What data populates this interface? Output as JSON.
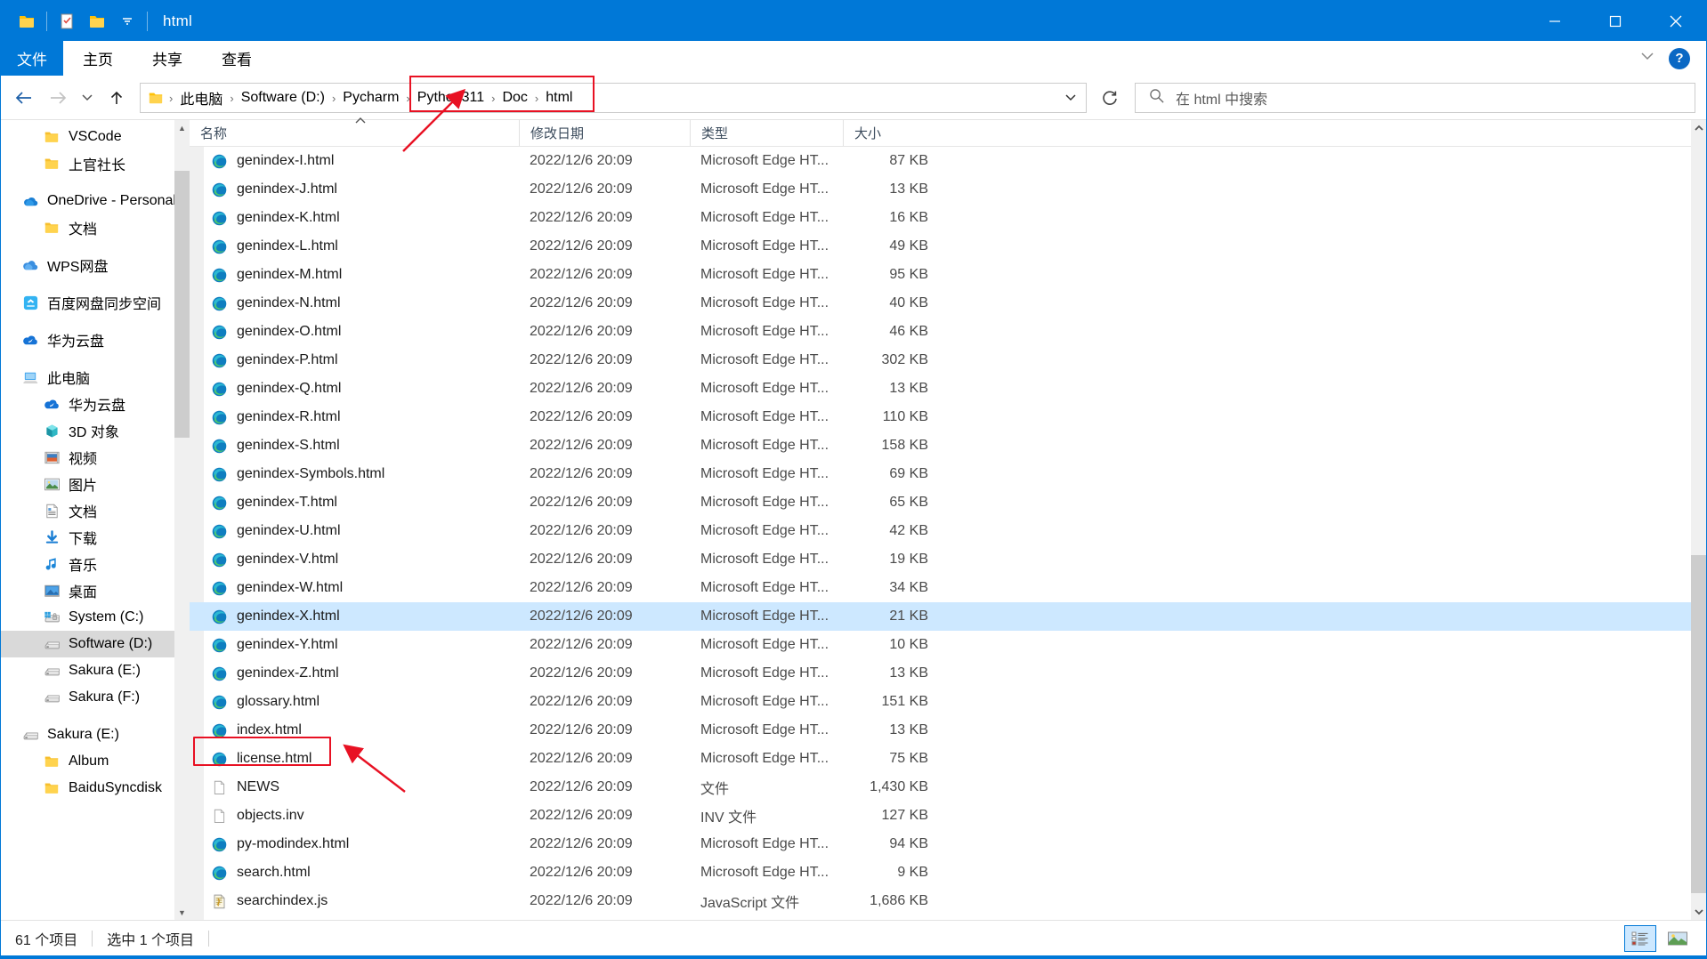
{
  "window": {
    "title": "html",
    "quick_access": [
      "folder-icon",
      "properties-icon",
      "new-folder-icon",
      "chevron-down-icon"
    ],
    "controls": {
      "minimize": "—",
      "maximize": "☐",
      "close": "✕"
    }
  },
  "ribbon": {
    "file_tab": "文件",
    "tabs": [
      "主页",
      "共享",
      "查看"
    ],
    "expand_label": "⌄",
    "help_label": "?"
  },
  "nav": {
    "back": "←",
    "forward": "→",
    "recent": "⌄",
    "up": "↑",
    "refresh": "↻",
    "address_caret": "⌄",
    "breadcrumbs": [
      "此电脑",
      "Software (D:)",
      "Pycharm",
      "Python311",
      "Doc",
      "html"
    ],
    "separator": "›",
    "highlight_from_index": 3
  },
  "search": {
    "placeholder": "在 html 中搜索",
    "icon": "search-icon"
  },
  "sidebar": {
    "items": [
      {
        "label": "VSCode",
        "icon": "folder-icon",
        "indent": 1,
        "selected": false,
        "gap_before": false
      },
      {
        "label": "上官社长",
        "icon": "folder-icon",
        "indent": 1,
        "selected": false,
        "gap_before": false
      },
      {
        "label": "OneDrive - Personal",
        "icon": "onedrive-icon",
        "indent": 0,
        "selected": false,
        "gap_before": true
      },
      {
        "label": "文档",
        "icon": "folder-icon",
        "indent": 1,
        "selected": false,
        "gap_before": false
      },
      {
        "label": "WPS网盘",
        "icon": "wps-cloud-icon",
        "indent": 0,
        "selected": false,
        "gap_before": true
      },
      {
        "label": "百度网盘同步空间",
        "icon": "baidu-cloud-icon",
        "indent": 0,
        "selected": false,
        "gap_before": true
      },
      {
        "label": "华为云盘",
        "icon": "huawei-cloud-icon",
        "indent": 0,
        "selected": false,
        "gap_before": true
      },
      {
        "label": "此电脑",
        "icon": "this-pc-icon",
        "indent": 0,
        "selected": false,
        "gap_before": true
      },
      {
        "label": "华为云盘",
        "icon": "huawei-cloud-icon",
        "indent": 1,
        "selected": false,
        "gap_before": false
      },
      {
        "label": "3D 对象",
        "icon": "3d-objects-icon",
        "indent": 1,
        "selected": false,
        "gap_before": false
      },
      {
        "label": "视频",
        "icon": "videos-icon",
        "indent": 1,
        "selected": false,
        "gap_before": false
      },
      {
        "label": "图片",
        "icon": "pictures-icon",
        "indent": 1,
        "selected": false,
        "gap_before": false
      },
      {
        "label": "文档",
        "icon": "documents-icon",
        "indent": 1,
        "selected": false,
        "gap_before": false
      },
      {
        "label": "下载",
        "icon": "downloads-icon",
        "indent": 1,
        "selected": false,
        "gap_before": false
      },
      {
        "label": "音乐",
        "icon": "music-icon",
        "indent": 1,
        "selected": false,
        "gap_before": false
      },
      {
        "label": "桌面",
        "icon": "desktop-icon",
        "indent": 1,
        "selected": false,
        "gap_before": false
      },
      {
        "label": "System (C:)",
        "icon": "system-drive-icon",
        "indent": 1,
        "selected": false,
        "gap_before": false
      },
      {
        "label": "Software (D:)",
        "icon": "drive-icon",
        "indent": 1,
        "selected": true,
        "gap_before": false
      },
      {
        "label": "Sakura (E:)",
        "icon": "drive-icon",
        "indent": 1,
        "selected": false,
        "gap_before": false
      },
      {
        "label": "Sakura (F:)",
        "icon": "drive-icon",
        "indent": 1,
        "selected": false,
        "gap_before": false
      },
      {
        "label": "Sakura (E:)",
        "icon": "drive-icon",
        "indent": 0,
        "selected": false,
        "gap_before": true
      },
      {
        "label": "Album",
        "icon": "folder-icon",
        "indent": 1,
        "selected": false,
        "gap_before": false
      },
      {
        "label": "BaiduSyncdisk",
        "icon": "folder-icon",
        "indent": 1,
        "selected": false,
        "gap_before": false
      }
    ]
  },
  "filelist": {
    "columns": [
      "名称",
      "修改日期",
      "类型",
      "大小"
    ],
    "sorted_column": 0,
    "sort_direction": "asc",
    "rows": [
      {
        "name": "genindex-I.html",
        "date": "2022/12/6 20:09",
        "type": "Microsoft Edge HT...",
        "size": "87 KB",
        "icon": "edge-icon",
        "selected": false
      },
      {
        "name": "genindex-J.html",
        "date": "2022/12/6 20:09",
        "type": "Microsoft Edge HT...",
        "size": "13 KB",
        "icon": "edge-icon",
        "selected": false
      },
      {
        "name": "genindex-K.html",
        "date": "2022/12/6 20:09",
        "type": "Microsoft Edge HT...",
        "size": "16 KB",
        "icon": "edge-icon",
        "selected": false
      },
      {
        "name": "genindex-L.html",
        "date": "2022/12/6 20:09",
        "type": "Microsoft Edge HT...",
        "size": "49 KB",
        "icon": "edge-icon",
        "selected": false
      },
      {
        "name": "genindex-M.html",
        "date": "2022/12/6 20:09",
        "type": "Microsoft Edge HT...",
        "size": "95 KB",
        "icon": "edge-icon",
        "selected": false
      },
      {
        "name": "genindex-N.html",
        "date": "2022/12/6 20:09",
        "type": "Microsoft Edge HT...",
        "size": "40 KB",
        "icon": "edge-icon",
        "selected": false
      },
      {
        "name": "genindex-O.html",
        "date": "2022/12/6 20:09",
        "type": "Microsoft Edge HT...",
        "size": "46 KB",
        "icon": "edge-icon",
        "selected": false
      },
      {
        "name": "genindex-P.html",
        "date": "2022/12/6 20:09",
        "type": "Microsoft Edge HT...",
        "size": "302 KB",
        "icon": "edge-icon",
        "selected": false
      },
      {
        "name": "genindex-Q.html",
        "date": "2022/12/6 20:09",
        "type": "Microsoft Edge HT...",
        "size": "13 KB",
        "icon": "edge-icon",
        "selected": false
      },
      {
        "name": "genindex-R.html",
        "date": "2022/12/6 20:09",
        "type": "Microsoft Edge HT...",
        "size": "110 KB",
        "icon": "edge-icon",
        "selected": false
      },
      {
        "name": "genindex-S.html",
        "date": "2022/12/6 20:09",
        "type": "Microsoft Edge HT...",
        "size": "158 KB",
        "icon": "edge-icon",
        "selected": false
      },
      {
        "name": "genindex-Symbols.html",
        "date": "2022/12/6 20:09",
        "type": "Microsoft Edge HT...",
        "size": "69 KB",
        "icon": "edge-icon",
        "selected": false
      },
      {
        "name": "genindex-T.html",
        "date": "2022/12/6 20:09",
        "type": "Microsoft Edge HT...",
        "size": "65 KB",
        "icon": "edge-icon",
        "selected": false
      },
      {
        "name": "genindex-U.html",
        "date": "2022/12/6 20:09",
        "type": "Microsoft Edge HT...",
        "size": "42 KB",
        "icon": "edge-icon",
        "selected": false
      },
      {
        "name": "genindex-V.html",
        "date": "2022/12/6 20:09",
        "type": "Microsoft Edge HT...",
        "size": "19 KB",
        "icon": "edge-icon",
        "selected": false
      },
      {
        "name": "genindex-W.html",
        "date": "2022/12/6 20:09",
        "type": "Microsoft Edge HT...",
        "size": "34 KB",
        "icon": "edge-icon",
        "selected": false
      },
      {
        "name": "genindex-X.html",
        "date": "2022/12/6 20:09",
        "type": "Microsoft Edge HT...",
        "size": "21 KB",
        "icon": "edge-icon",
        "selected": true
      },
      {
        "name": "genindex-Y.html",
        "date": "2022/12/6 20:09",
        "type": "Microsoft Edge HT...",
        "size": "10 KB",
        "icon": "edge-icon",
        "selected": false
      },
      {
        "name": "genindex-Z.html",
        "date": "2022/12/6 20:09",
        "type": "Microsoft Edge HT...",
        "size": "13 KB",
        "icon": "edge-icon",
        "selected": false
      },
      {
        "name": "glossary.html",
        "date": "2022/12/6 20:09",
        "type": "Microsoft Edge HT...",
        "size": "151 KB",
        "icon": "edge-icon",
        "selected": false
      },
      {
        "name": "index.html",
        "date": "2022/12/6 20:09",
        "type": "Microsoft Edge HT...",
        "size": "13 KB",
        "icon": "edge-icon",
        "selected": false,
        "annotated": true
      },
      {
        "name": "license.html",
        "date": "2022/12/6 20:09",
        "type": "Microsoft Edge HT...",
        "size": "75 KB",
        "icon": "edge-icon",
        "selected": false
      },
      {
        "name": "NEWS",
        "date": "2022/12/6 20:09",
        "type": "文件",
        "size": "1,430 KB",
        "icon": "generic-file-icon",
        "selected": false
      },
      {
        "name": "objects.inv",
        "date": "2022/12/6 20:09",
        "type": "INV 文件",
        "size": "127 KB",
        "icon": "generic-file-icon",
        "selected": false
      },
      {
        "name": "py-modindex.html",
        "date": "2022/12/6 20:09",
        "type": "Microsoft Edge HT...",
        "size": "94 KB",
        "icon": "edge-icon",
        "selected": false
      },
      {
        "name": "search.html",
        "date": "2022/12/6 20:09",
        "type": "Microsoft Edge HT...",
        "size": "9 KB",
        "icon": "edge-icon",
        "selected": false
      },
      {
        "name": "searchindex.js",
        "date": "2022/12/6 20:09",
        "type": "JavaScript 文件",
        "size": "1,686 KB",
        "icon": "javascript-file-icon",
        "selected": false
      }
    ]
  },
  "statusbar": {
    "item_count": "61 个项目",
    "selection": "选中 1 个项目",
    "views": [
      "details-view-button",
      "large-icons-view-button"
    ],
    "active_view": 0
  }
}
